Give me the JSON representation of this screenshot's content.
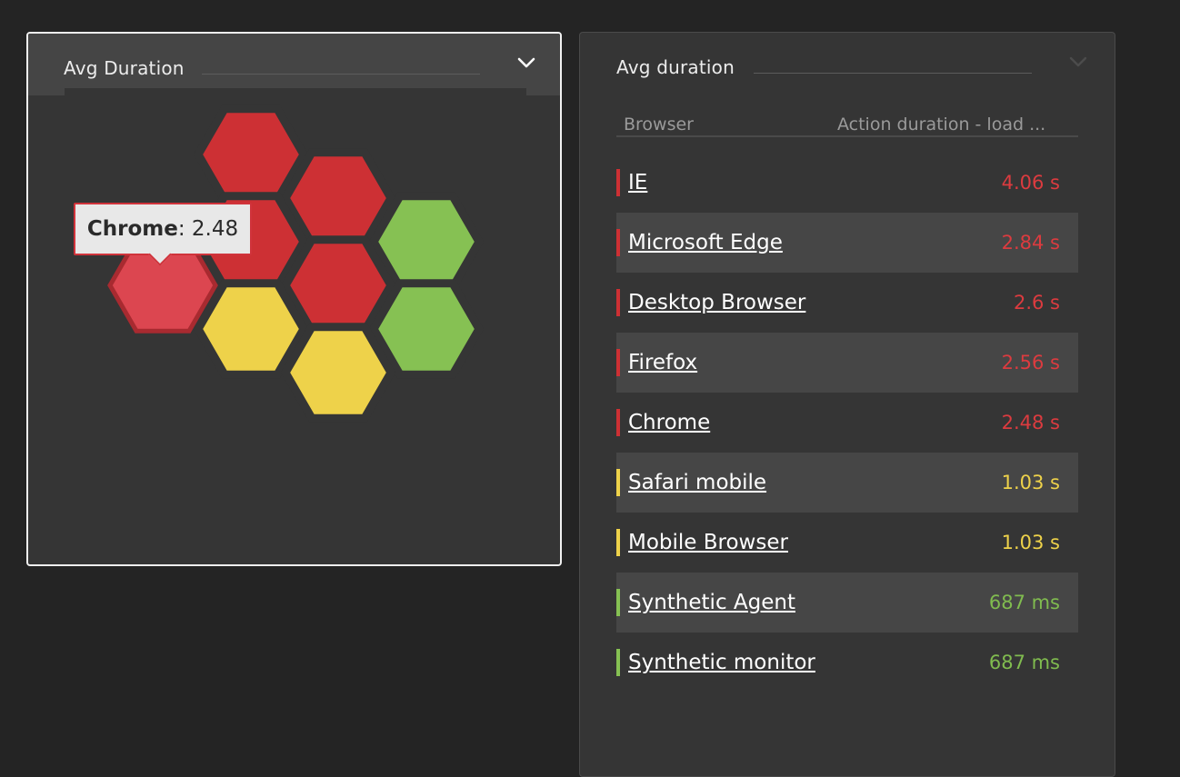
{
  "left_panel": {
    "title": "Avg Duration",
    "tooltip": {
      "label": "Chrome",
      "value": "2.48"
    }
  },
  "right_panel": {
    "title": "Avg duration",
    "columns": {
      "browser": "Browser",
      "duration": "Action duration - load ..."
    },
    "rows": [
      {
        "name": "IE",
        "value": "4.06 s",
        "status": "red"
      },
      {
        "name": "Microsoft Edge",
        "value": "2.84 s",
        "status": "red"
      },
      {
        "name": "Desktop Browser",
        "value": "2.6 s",
        "status": "red"
      },
      {
        "name": "Firefox",
        "value": "2.56 s",
        "status": "red"
      },
      {
        "name": "Chrome",
        "value": "2.48 s",
        "status": "red"
      },
      {
        "name": "Safari mobile",
        "value": "1.03 s",
        "status": "yellow"
      },
      {
        "name": "Mobile Browser",
        "value": "1.03 s",
        "status": "yellow"
      },
      {
        "name": "Synthetic Agent",
        "value": "687 ms",
        "status": "green"
      },
      {
        "name": "Synthetic monitor",
        "value": "687 ms",
        "status": "green"
      }
    ]
  },
  "colors": {
    "red": "#cd3034",
    "red_value": "#dc3b3f",
    "red_highlight": "#dc4650",
    "yellow": "#eed24a",
    "green": "#86c153",
    "green_value": "#80bb4f"
  },
  "icons": {
    "collapse": "chevron-down-icon"
  }
}
